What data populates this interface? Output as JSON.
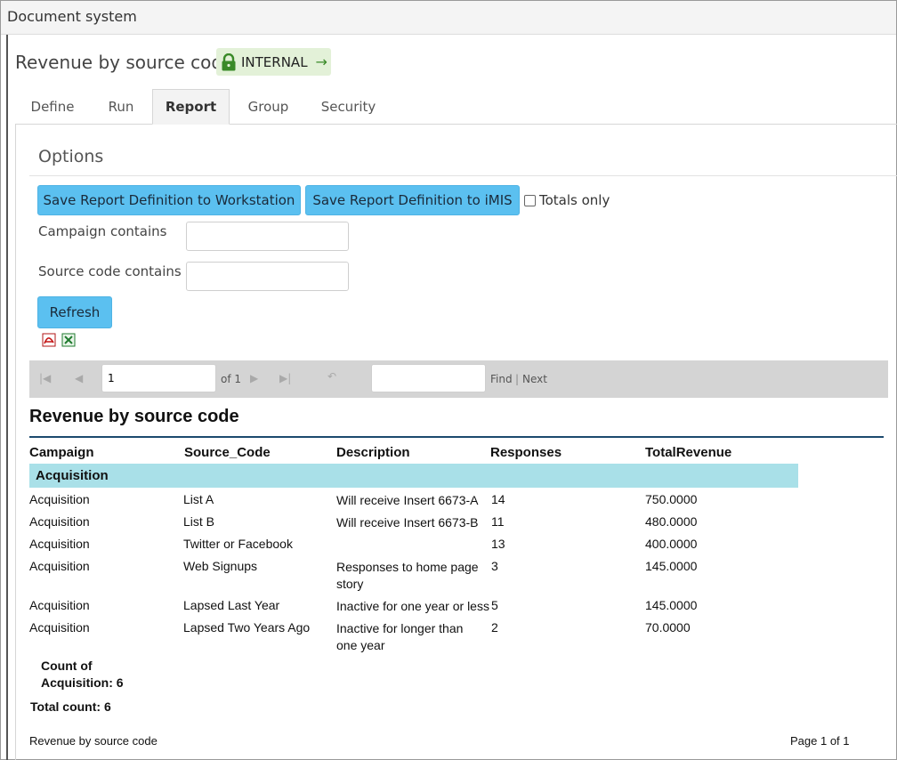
{
  "window": {
    "title": "Document system"
  },
  "header": {
    "title": "Revenue by source code",
    "badge": "INTERNAL"
  },
  "tabs": [
    {
      "label": "Define"
    },
    {
      "label": "Run"
    },
    {
      "label": "Report"
    },
    {
      "label": "Group"
    },
    {
      "label": "Security"
    }
  ],
  "options": {
    "title": "Options",
    "save_workstation": "Save Report Definition to Workstation",
    "save_imis": "Save Report Definition to iMIS",
    "totals_only": "Totals only",
    "campaign_label": "Campaign contains",
    "campaign_value": "",
    "source_label": "Source code contains",
    "source_value": "",
    "refresh": "Refresh"
  },
  "pager": {
    "page_value": "1",
    "of_label": "of 1",
    "find_value": "",
    "find_label": "Find",
    "separator": "|",
    "next_label": "Next"
  },
  "report": {
    "title": "Revenue by source code",
    "columns": [
      "Campaign",
      "Source_Code",
      "Description",
      "Responses",
      "TotalRevenue"
    ],
    "group_name": "Acquisition",
    "rows": [
      {
        "campaign": "Acquisition",
        "source": "List A",
        "description": "Will receive Insert 6673-A",
        "responses": "14",
        "revenue": "750.0000"
      },
      {
        "campaign": "Acquisition",
        "source": "List B",
        "description": "Will receive Insert 6673-B",
        "responses": "11",
        "revenue": "480.0000"
      },
      {
        "campaign": "Acquisition",
        "source": "Twitter or Facebook",
        "description": "",
        "responses": "13",
        "revenue": "400.0000"
      },
      {
        "campaign": "Acquisition",
        "source": "Web Signups",
        "description": "Responses to home page story",
        "responses": "3",
        "revenue": "145.0000"
      },
      {
        "campaign": "Acquisition",
        "source": "Lapsed Last Year",
        "description": "Inactive for one year or less",
        "responses": "5",
        "revenue": "145.0000"
      },
      {
        "campaign": "Acquisition",
        "source": "Lapsed Two Years Ago",
        "description": "Inactive for longer than one year",
        "responses": "2",
        "revenue": "70.0000"
      }
    ],
    "group_count_line1": "Count of",
    "group_count_line2": "Acquisition: 6",
    "total_count": "Total count: 6",
    "footer_left": "Revenue by source code",
    "footer_right": "Page 1 of 1"
  }
}
